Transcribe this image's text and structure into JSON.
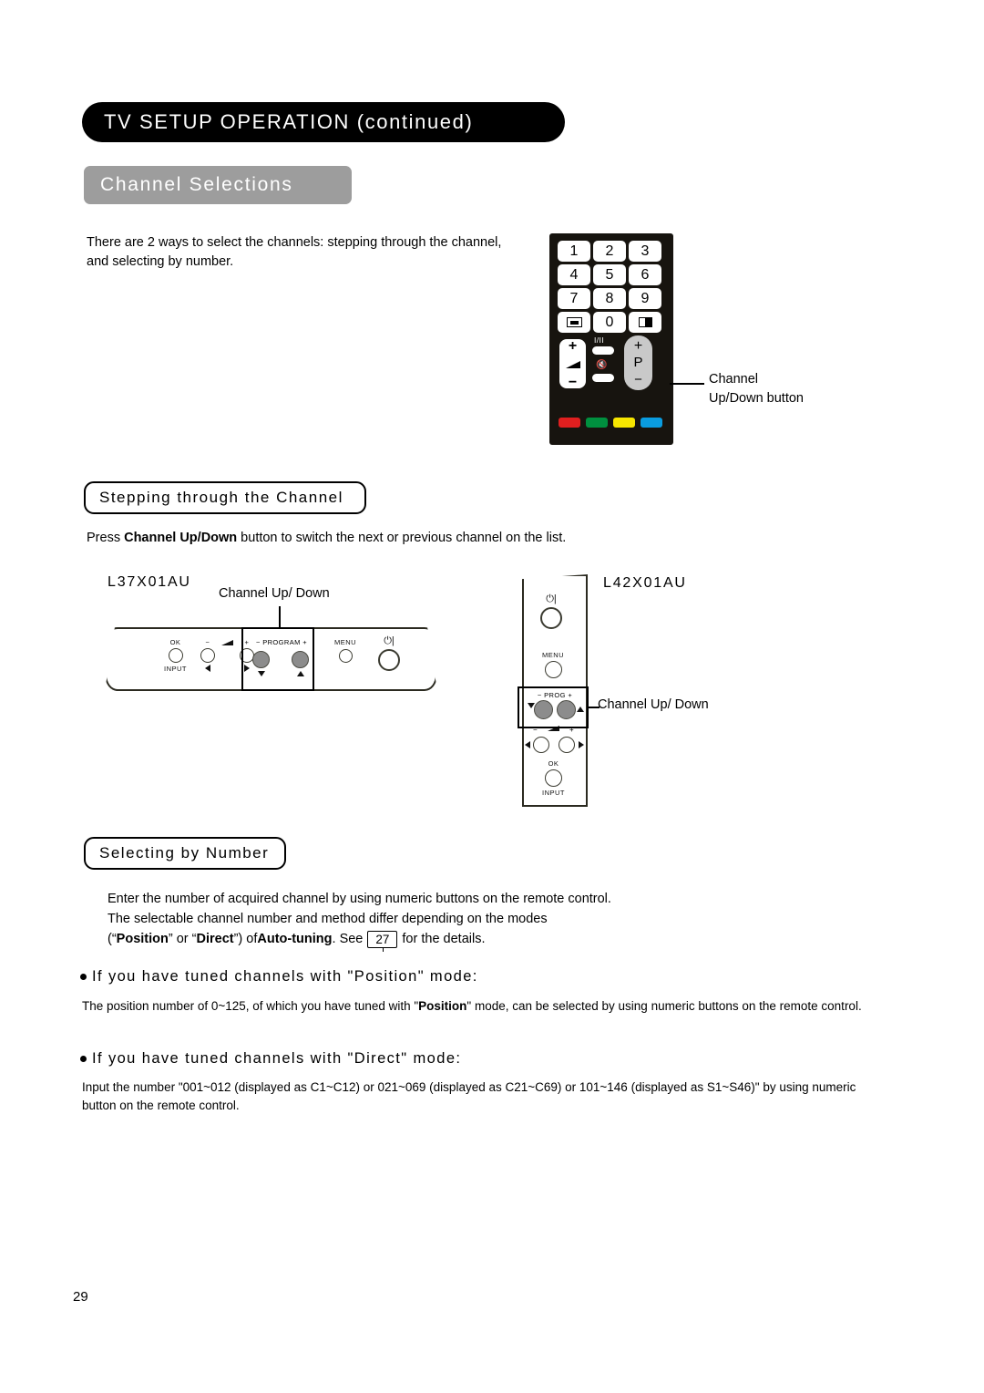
{
  "header": {
    "title": "TV SETUP OPERATION (continued)"
  },
  "section": {
    "title": "Channel Selections"
  },
  "intro": {
    "text": "There are 2 ways to select the channels: stepping through the channel, and selecting by number."
  },
  "remote": {
    "keys": [
      {
        "label": "1",
        "type": "digit"
      },
      {
        "label": "2",
        "type": "digit"
      },
      {
        "label": "3",
        "type": "digit"
      },
      {
        "label": "4",
        "type": "digit"
      },
      {
        "label": "5",
        "type": "digit"
      },
      {
        "label": "6",
        "type": "digit"
      },
      {
        "label": "7",
        "type": "digit"
      },
      {
        "label": "8",
        "type": "digit"
      },
      {
        "label": "9",
        "type": "digit"
      },
      {
        "label": "",
        "type": "teletext-icon"
      },
      {
        "label": "0",
        "type": "digit"
      },
      {
        "label": "",
        "type": "picture-mode-icon"
      }
    ],
    "volume_plus": "+",
    "volume_minus": "−",
    "sound_mode_label": "I/II",
    "mute_icon": "mute-icon",
    "p_plus": "+",
    "p_label": "P",
    "p_minus": "−",
    "color_buttons": [
      {
        "name": "red",
        "color": "#e01f1f"
      },
      {
        "name": "green",
        "color": "#00903f"
      },
      {
        "name": "yellow",
        "color": "#f7e600"
      },
      {
        "name": "blue",
        "color": "#0a9ce0"
      }
    ],
    "callout_line1": "Channel",
    "callout_line2": "Up/Down button"
  },
  "stepping": {
    "subhead": "Stepping through the Channel",
    "body_pre": "Press ",
    "body_bold1": "Channel Up",
    "body_slash": "/",
    "body_bold2": "Down",
    "body_post": " button to switch the next or previous channel on the list."
  },
  "panels": {
    "l37": {
      "model": "L37X01AU",
      "callout": "Channel Up/ Down",
      "controls": [
        {
          "top": "OK",
          "bottom": "INPUT"
        },
        {
          "top": "−",
          "bottom": "◀"
        },
        {
          "top": "+",
          "bottom": "▶"
        },
        {
          "top": "− PROGRAM +",
          "bottom_left": "▼",
          "bottom_right": "▲"
        },
        {
          "top": "MENU",
          "bottom": ""
        },
        {
          "top": "power",
          "bottom": ""
        }
      ]
    },
    "l42": {
      "model": "L42X01AU",
      "callout": "Channel Up/ Down",
      "controls": [
        {
          "label": "power"
        },
        {
          "label": "MENU"
        },
        {
          "label": "− PROG +"
        },
        {
          "label": "volume"
        },
        {
          "label": "OK"
        },
        {
          "label": "INPUT"
        }
      ]
    }
  },
  "selecting": {
    "subhead": "Selecting by Number",
    "line1": "Enter the number of acquired channel by using numeric buttons on the remote control.",
    "line2": "The selectable channel number and method differ depending on the modes",
    "line3_pre": "(“",
    "line3_bold1": "Position",
    "line3_mid1": "” or “",
    "line3_bold2": "Direct",
    "line3_mid2": "”) of ",
    "line3_bold3": "Auto-tuning",
    "line3_mid3": ". See ",
    "page_ref": "27",
    "line3_post": " for the details."
  },
  "position_mode": {
    "heading": "If you have tuned channels with \"Position\" mode:",
    "body_pre": "The position number of 0~125, of which you have tuned with \"",
    "body_bold": "Position",
    "body_post": "\" mode, can be selected by using numeric buttons on the remote control."
  },
  "direct_mode": {
    "heading": "If you have tuned channels with \"Direct\" mode:",
    "body": "Input the number \"001~012 (displayed as C1~C12) or 021~069 (displayed as C21~C69) or 101~146 (displayed as S1~S46)\" by using numeric button on the remote control."
  },
  "footer": {
    "page_number": "29"
  }
}
